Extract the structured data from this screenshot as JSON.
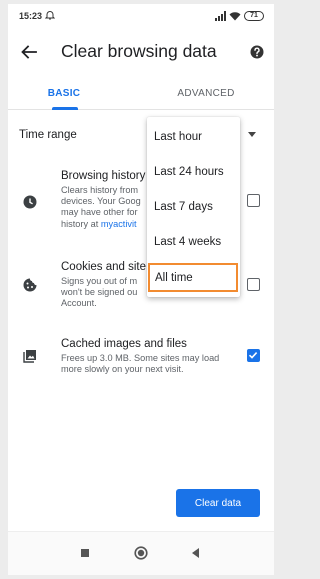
{
  "status_bar": {
    "time": "15:23",
    "battery": "71"
  },
  "app_bar": {
    "title": "Clear browsing data"
  },
  "tabs": [
    {
      "label": "BASIC",
      "selected": true
    },
    {
      "label": "ADVANCED",
      "selected": false
    }
  ],
  "time_range": {
    "label": "Time range"
  },
  "options": {
    "history": {
      "title": "Browsing history",
      "desc_prefix": "Clears history from",
      "desc_line2": "devices. Your Goog",
      "desc_line3": "may have other for",
      "desc_line4_prefix": "history at",
      "desc_link": "myactivit",
      "checked": false
    },
    "cookies": {
      "title": "Cookies and site",
      "desc_line1": "Signs you out of m",
      "desc_line2": "won't be signed ou",
      "desc_line3": "Account.",
      "checked": false
    },
    "cache": {
      "title": "Cached images and files",
      "desc": "Frees up 3.0 MB. Some sites may load more slowly on your next visit.",
      "checked": true
    }
  },
  "menu": {
    "items": [
      "Last hour",
      "Last 24 hours",
      "Last 7 days",
      "Last 4 weeks",
      "All time"
    ],
    "highlighted_index": 4
  },
  "clear_button": {
    "label": "Clear data"
  },
  "colors": {
    "accent": "#1a73e8",
    "highlight": "#f28b30"
  },
  "icons": {
    "back": "arrow-back-icon",
    "help": "help-icon",
    "history": "clock-icon",
    "cookies": "cookie-icon",
    "cache": "image-icon"
  }
}
